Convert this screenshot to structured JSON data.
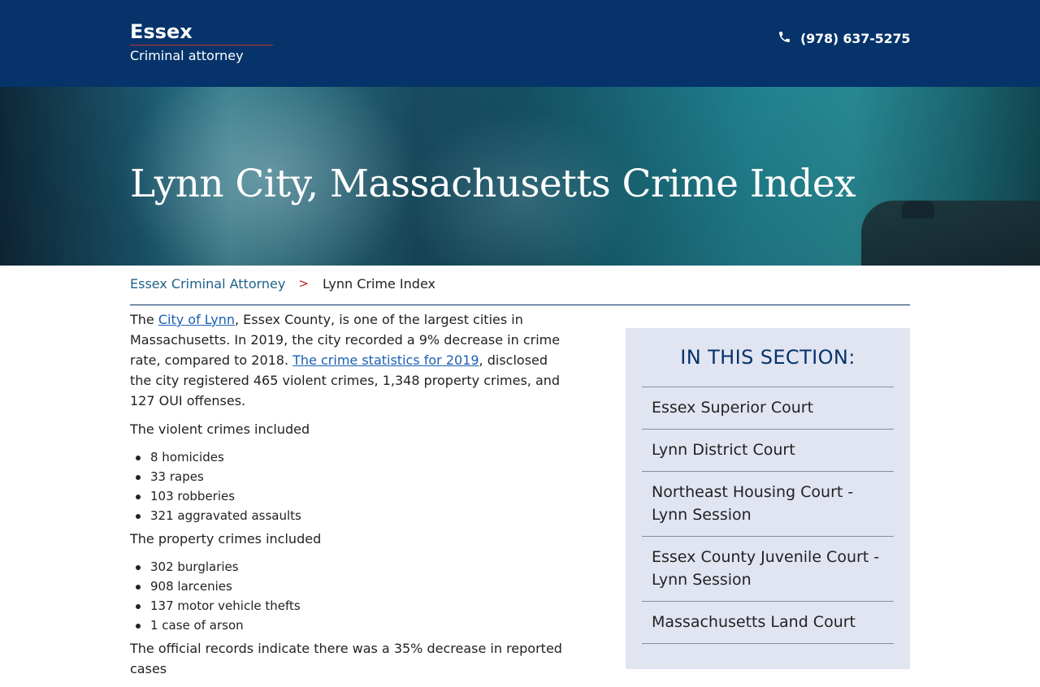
{
  "header": {
    "logo_title": "Essex",
    "logo_subtitle": "Criminal attorney",
    "phone": "(978) 637-5275"
  },
  "hero": {
    "title": "Lynn City, Massachusetts Crime Index"
  },
  "breadcrumb": {
    "home": "Essex Criminal Attorney",
    "separator": ">",
    "current": "Lynn Crime Index"
  },
  "content": {
    "intro": {
      "pre": "The ",
      "link1": "City of Lynn",
      "mid": ", Essex County, is one of the largest cities in Massachusetts. In 2019, the city recorded a 9% decrease in crime rate, compared to 2018. ",
      "link2": "The crime statistics for 2019",
      "post": ", disclosed the city registered 465 violent crimes, 1,348 property crimes, and 127 OUI offenses."
    },
    "violent_heading": "The violent crimes included",
    "violent_items": [
      "8 homicides",
      "33 rapes",
      "103 robberies",
      "321 aggravated assaults"
    ],
    "property_heading": "The property crimes included",
    "property_items": [
      "302 burglaries",
      "908 larcenies",
      "137 motor vehicle thefts",
      "1 case of arson"
    ],
    "trailing": "The official records indicate there was a 35% decrease in reported cases"
  },
  "sidebar": {
    "title": "IN THIS SECTION:",
    "items": [
      "Essex Superior Court",
      "Lynn District Court",
      "Northeast Housing Court - Lynn Session",
      "Essex County Juvenile Court - Lynn Session",
      "Massachusetts Land Court"
    ]
  },
  "colors": {
    "header_bg": "#05336a",
    "accent_red": "#c0392b",
    "link": "#1a5fb4",
    "sidebar_bg": "#e1e5f2"
  },
  "icons": {
    "phone": "phone-icon"
  }
}
